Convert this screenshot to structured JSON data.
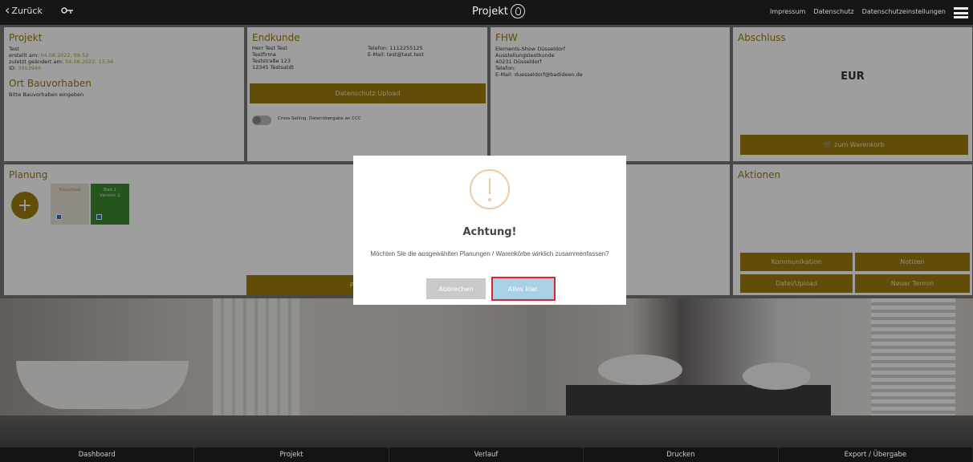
{
  "topbar": {
    "back_label": "Zurück",
    "key_icon": "key-icon",
    "brand": "Projekt",
    "links": [
      "Impressum",
      "Datenschutz",
      "Datenschutzeinstellungen"
    ],
    "menu_icon": "hamburger-icon"
  },
  "projekt": {
    "title": "Projekt",
    "name": "Test",
    "created_label": "erstellt am:",
    "created_value": "04.08.2022, 09:52",
    "changed_label": "zuletzt geändert am:",
    "changed_value": "04.08.2022, 13:34",
    "id_label": "ID:",
    "id_value": "3953946",
    "ort_title": "Ort Bauvorhaben",
    "ort_placeholder": "Bitte Bauvorhaben eingeben"
  },
  "endkunde": {
    "title": "Endkunde",
    "lines": [
      "Herr Test Test",
      "Testfirma",
      "Teststraße 123",
      "12345 Testsatdt"
    ],
    "telefon": "Telefon: 1112255125",
    "email": "E-Mail: test@test.test",
    "upload_button": "Datenschutz Upload",
    "toggle_label": "Cross-Selling, Datenübergabe an CCC"
  },
  "fhw": {
    "title": "FHW",
    "lines": [
      "Elements-Show Düsseldorf",
      "Ausstellungstestkunde",
      "40231 Düsseldorf",
      "Telefon:",
      "E-Mail: duesseldorf@badideen.de"
    ]
  },
  "abschluss": {
    "title": "Abschluss",
    "currency": "EUR",
    "cart_button": "zum Warenkorb"
  },
  "planung": {
    "title": "Planung",
    "tiles": [
      {
        "label": "Hauptbad",
        "sub": ""
      },
      {
        "label": "Bad 1",
        "sub": "Version 2"
      }
    ],
    "bottom_button": "Planungen"
  },
  "aktionen": {
    "title": "Aktionen",
    "buttons": [
      "Kommunikation",
      "Notizen",
      "Datei/Upload",
      "Neuer Termin"
    ]
  },
  "modal": {
    "icon": "warning-icon",
    "title": "Achtung!",
    "text": "Möchten Sie die ausgewählten Planungen / Warenkörbe wirklich zusammenfassen?",
    "cancel": "Abbrechen",
    "confirm": "Alles klar."
  },
  "bottomnav": [
    "Dashboard",
    "Projekt",
    "Verlauf",
    "Drucken",
    "Export / Übergabe"
  ],
  "colors": {
    "accent": "#9e7b0f",
    "confirm_button": "#a9d1e6",
    "highlight_border": "#e0262a",
    "tile_green": "#3b8a2e"
  }
}
